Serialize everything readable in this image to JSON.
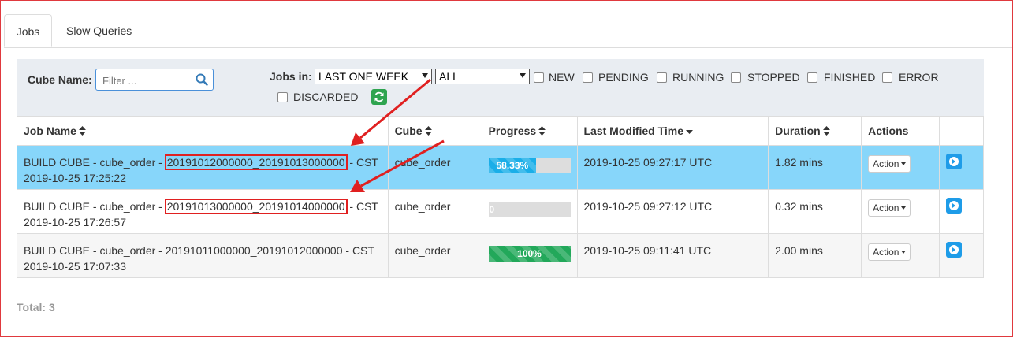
{
  "tabs": {
    "jobs": "Jobs",
    "slow_queries": "Slow Queries"
  },
  "filters": {
    "cube_name_label": "Cube Name:",
    "filter_placeholder": "Filter ...",
    "jobs_in_label": "Jobs in:",
    "time_range": "LAST ONE WEEK",
    "project": "ALL",
    "statuses": [
      "NEW",
      "PENDING",
      "RUNNING",
      "STOPPED",
      "FINISHED",
      "ERROR",
      "DISCARDED"
    ]
  },
  "table": {
    "headers": {
      "job_name": "Job Name",
      "cube": "Cube",
      "progress": "Progress",
      "last_modified": "Last Modified Time",
      "duration": "Duration",
      "actions": "Actions"
    },
    "rows": [
      {
        "job_prefix": "BUILD CUBE - cube_order - ",
        "segment": "20191012000000_20191013000000",
        "job_suffix": " - CST",
        "job_time": "2019-10-25 17:25:22",
        "cube": "cube_order",
        "progress_label": "58.33%",
        "progress_value": 58.33,
        "last_modified": "2019-10-25 09:27:17 UTC",
        "duration": "1.82 mins",
        "action": "Action"
      },
      {
        "job_prefix": "BUILD CUBE - cube_order - ",
        "segment": "20191013000000_20191014000000",
        "job_suffix": " - CST",
        "job_time": "2019-10-25 17:26:57",
        "cube": "cube_order",
        "progress_label": "0",
        "progress_value": 0,
        "last_modified": "2019-10-25 09:27:12 UTC",
        "duration": "0.32 mins",
        "action": "Action"
      },
      {
        "job_prefix": "BUILD CUBE - cube_order - ",
        "segment": "20191011000000_20191012000000",
        "job_suffix": " - CST",
        "job_time": "2019-10-25 17:07:33",
        "cube": "cube_order",
        "progress_label": "100%",
        "progress_value": 100,
        "last_modified": "2019-10-25 09:11:41 UTC",
        "duration": "2.00 mins",
        "action": "Action"
      }
    ]
  },
  "total": "Total: 3",
  "colors": {
    "highlight_row": "#87d6fa",
    "running": "#1aaee8",
    "finished": "#22a85a",
    "annotation": "#e02020"
  }
}
